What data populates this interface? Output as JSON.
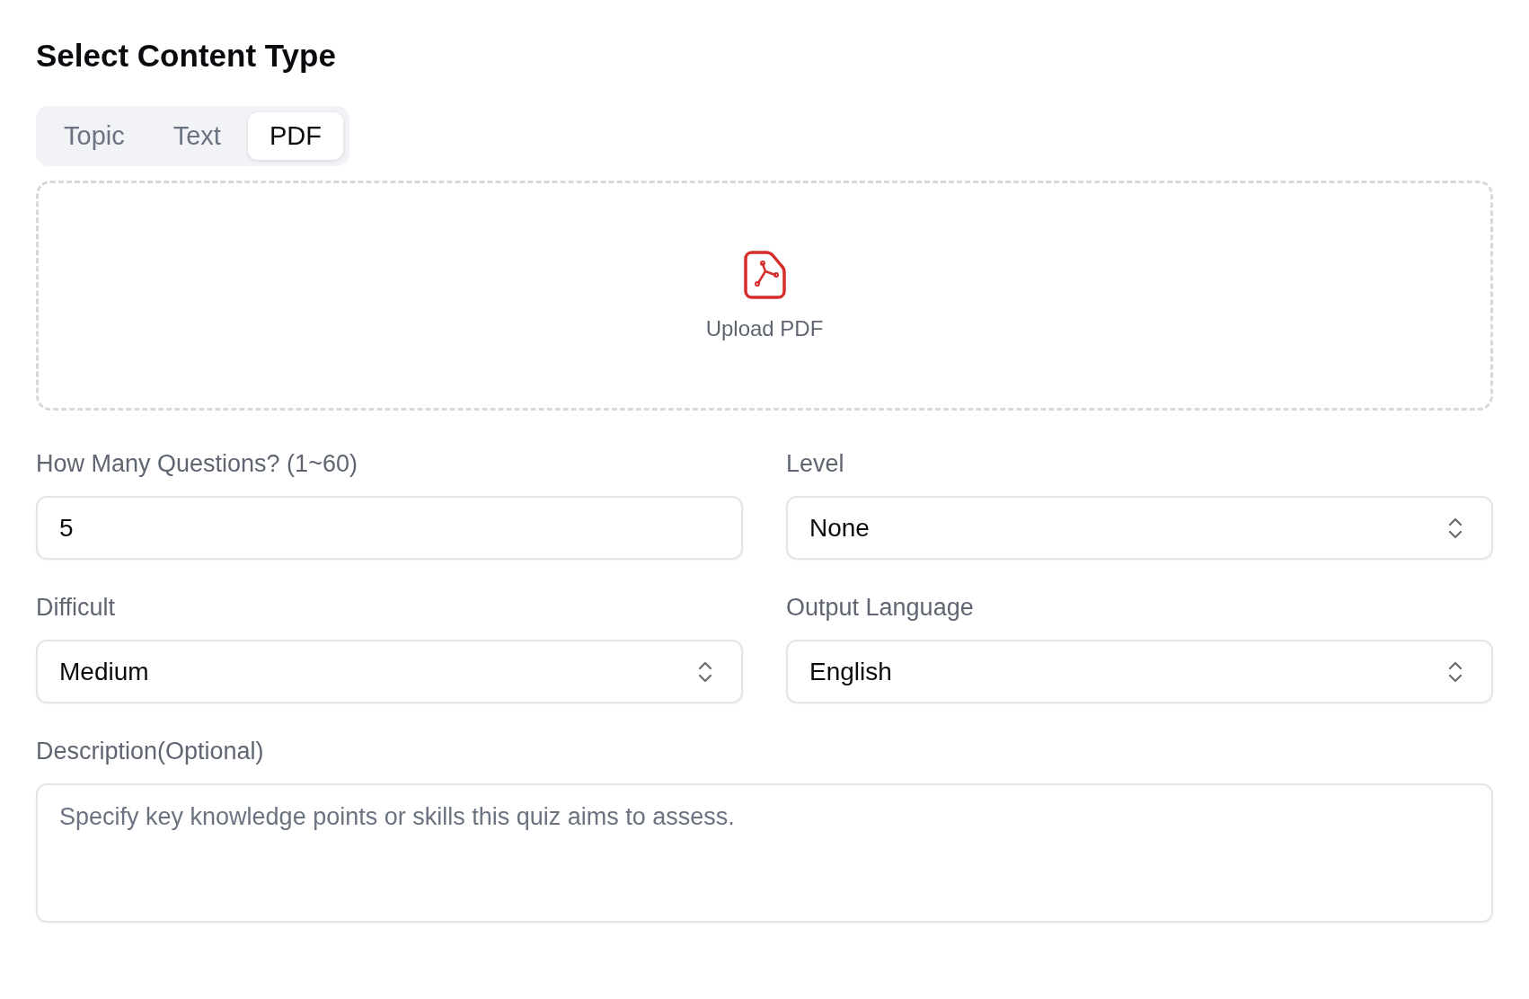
{
  "title": "Select Content Type",
  "tabs": [
    {
      "label": "Topic",
      "selected": false
    },
    {
      "label": "Text",
      "selected": false
    },
    {
      "label": "PDF",
      "selected": true
    }
  ],
  "upload": {
    "label": "Upload PDF"
  },
  "fields": [
    {
      "kind": "input",
      "label": "How Many Questions? (1~60)",
      "value": "5"
    },
    {
      "kind": "select",
      "label": "Level",
      "value": "None"
    },
    {
      "kind": "select",
      "label": "Difficult",
      "value": "Medium"
    },
    {
      "kind": "select",
      "label": "Output Language",
      "value": "English"
    }
  ],
  "description": {
    "label": "Description(Optional)",
    "placeholder": "Specify key knowledge points or skills this quiz aims to assess."
  }
}
